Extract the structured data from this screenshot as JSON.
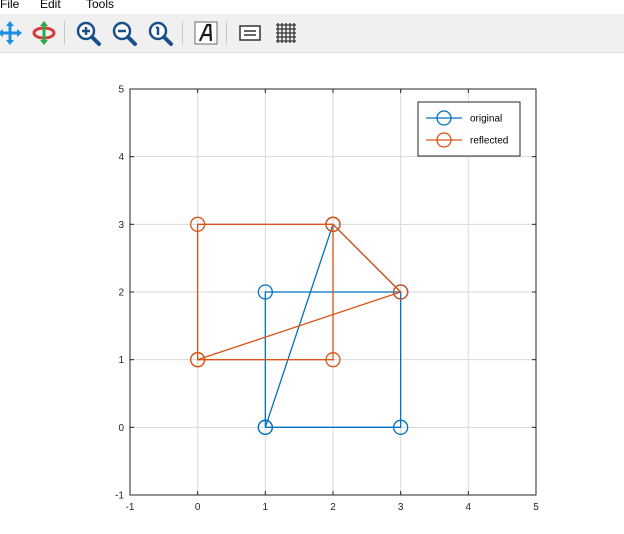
{
  "menu": {
    "file": "File",
    "edit": "Edit",
    "tools": "Tools"
  },
  "toolbar": {
    "tools": [
      "pan-icon",
      "rotate-3d-icon",
      "zoom-in-icon",
      "zoom-out-icon",
      "zoom-reset-icon",
      "insert-text-icon",
      "legend-toggle-icon",
      "grid-toggle-icon"
    ]
  },
  "colors": {
    "original": "#0072bd",
    "reflected": "#d95319",
    "grid": "#d9d9d9",
    "axis": "#262626"
  },
  "chart_data": {
    "type": "line",
    "xlim": [
      -1,
      5
    ],
    "ylim": [
      -1,
      5
    ],
    "xticks": [
      "-1",
      "0",
      "1",
      "2",
      "3",
      "4",
      "5"
    ],
    "yticks": [
      "-1",
      "0",
      "1",
      "2",
      "3",
      "4",
      "5"
    ],
    "grid": true,
    "legend_position": "top-right",
    "marker": "circle",
    "series": [
      {
        "name": "original",
        "x": [
          1,
          3,
          3,
          1,
          1,
          2,
          3
        ],
        "y": [
          0,
          0,
          2,
          2,
          0,
          3,
          2
        ]
      },
      {
        "name": "reflected",
        "x": [
          0,
          2,
          2,
          0,
          0,
          3,
          2
        ],
        "y": [
          1,
          1,
          3,
          3,
          1,
          2,
          3
        ]
      }
    ],
    "title": "",
    "xlabel": "",
    "ylabel": ""
  }
}
